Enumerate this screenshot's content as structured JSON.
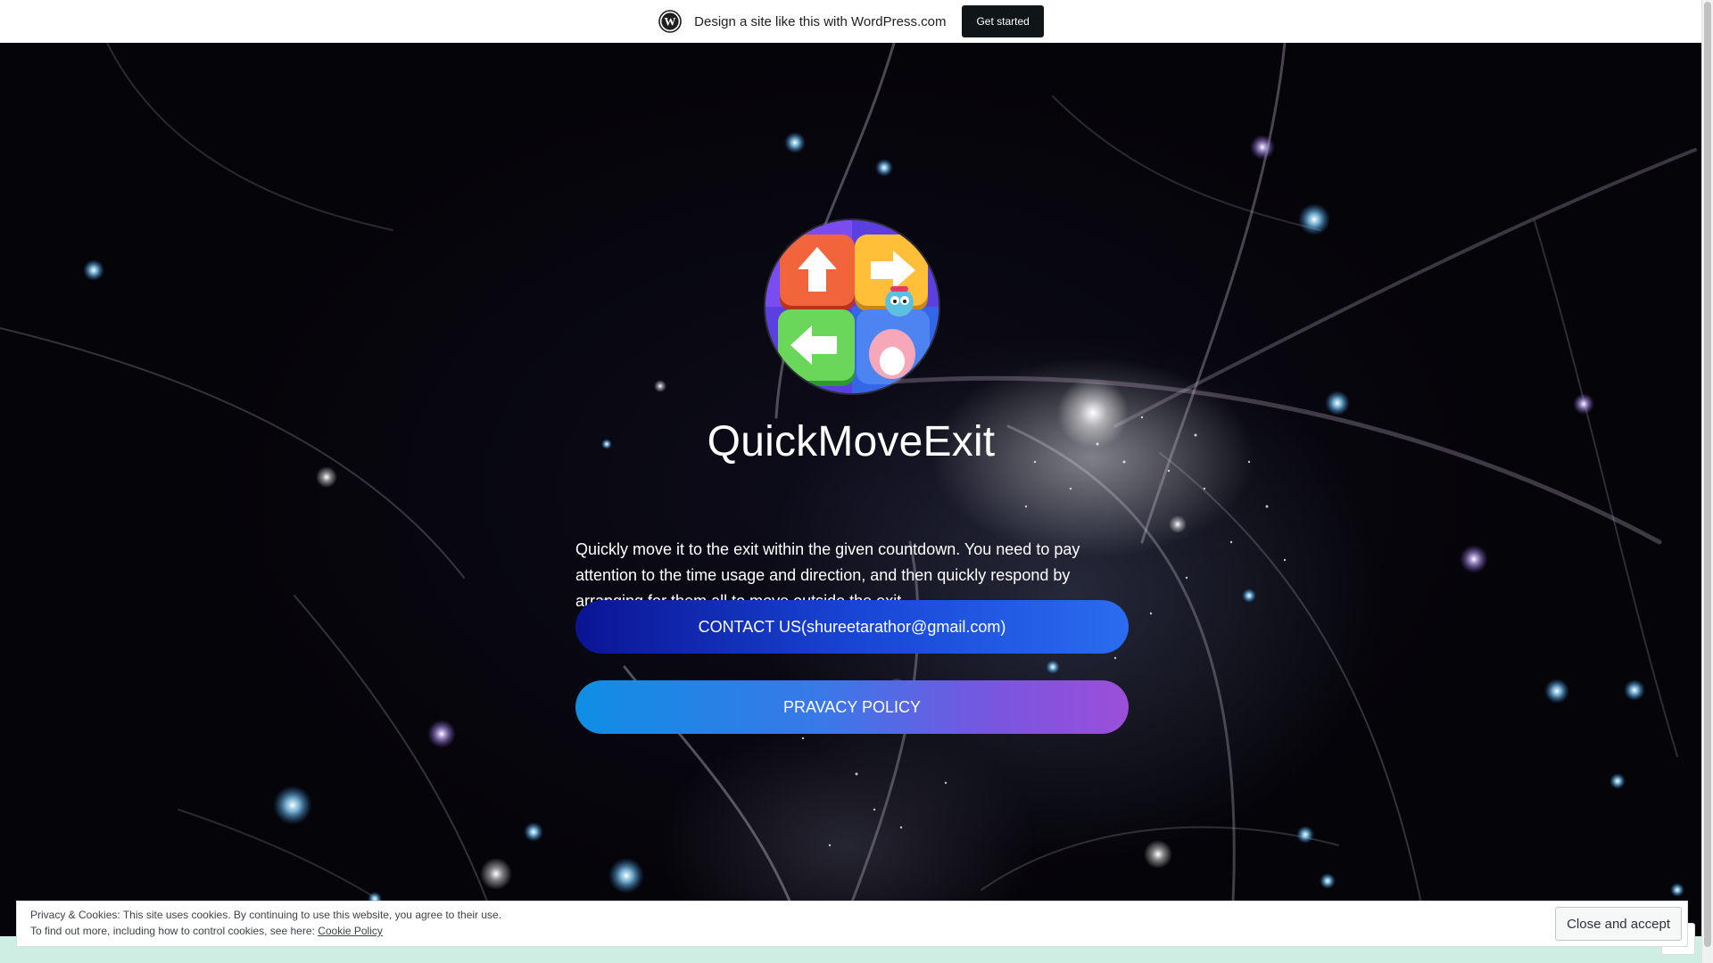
{
  "wp_bar": {
    "logo_icon": "wordpress-logo-icon",
    "promo_text": "Design a site like this with WordPress.com",
    "cta_label": "Get started"
  },
  "site": {
    "logo_icon": "quickmoveexit-app-icon",
    "title": "QuickMoveExit",
    "description": "Quickly move it to the exit within the given countdown. You need to pay attention to the time usage and direction, and then quickly respond by arranging for them all to move outside the exit"
  },
  "buttons": {
    "contact_label": "CONTACT US(shureetarathor@gmail.com)",
    "privacy_label": "PRAVACY POLICY"
  },
  "cookie": {
    "line1": "Privacy & Cookies: This site uses cookies. By continuing to use this website, you agree to their use.",
    "line2_prefix": "To find out more, including how to control cookies, see here: ",
    "policy_link": "Cookie Policy",
    "accept_label": "Close and accept"
  },
  "colors": {
    "contact_gradient": [
      "#0a1493",
      "#2a6cf0"
    ],
    "privacy_gradient": [
      "#0f8ee4",
      "#9b4fd8"
    ],
    "hero_background": "#050409",
    "footer_background": "#cfeee3"
  }
}
